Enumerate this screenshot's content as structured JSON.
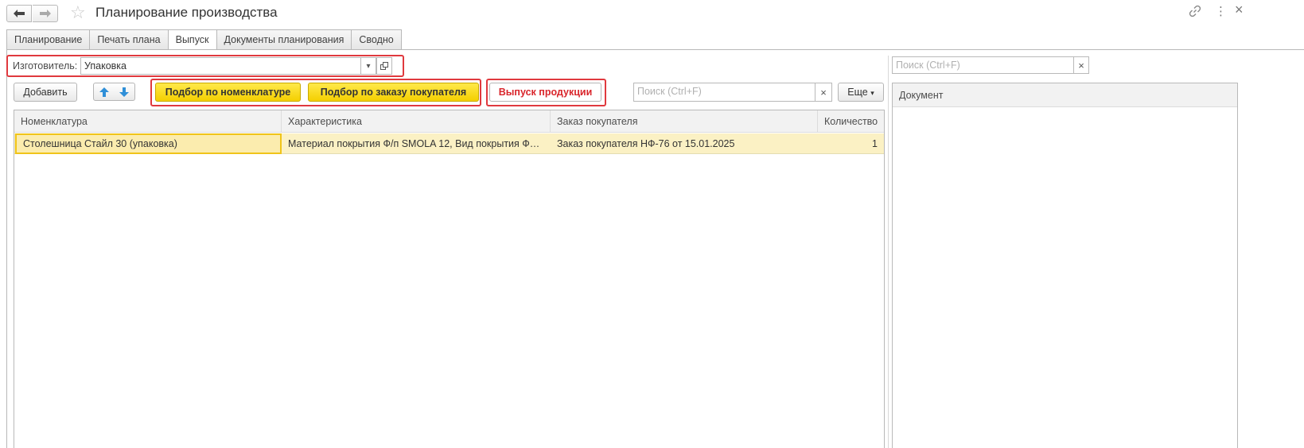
{
  "window": {
    "title": "Планирование производства"
  },
  "tabs": [
    {
      "label": "Планирование",
      "active": false
    },
    {
      "label": "Печать плана",
      "active": false
    },
    {
      "label": "Выпуск",
      "active": true
    },
    {
      "label": "Документы планирования",
      "active": false
    },
    {
      "label": "Сводно",
      "active": false
    }
  ],
  "manufacturer": {
    "label": "Изготовитель:",
    "value": "Упаковка"
  },
  "toolbar": {
    "add_label": "Добавить",
    "pick_by_nomenclature": "Подбор по номенклатуре",
    "pick_by_customer_order": "Подбор по заказу покупателя",
    "release_production": "Выпуск продукции",
    "search_placeholder": "Поиск (Ctrl+F)",
    "more_label": "Еще"
  },
  "table": {
    "columns": [
      "Номенклатура",
      "Характеристика",
      "Заказ покупателя",
      "Количество"
    ],
    "rows": [
      {
        "nomenclature": "Столешница Стайл 30 (упаковка)",
        "characteristic": "Материал покрытия Ф/п SMOLA 12, Вид покрытия Ф…",
        "order": "Заказ покупателя НФ-76 от 15.01.2025",
        "quantity": "1"
      }
    ]
  },
  "right_panel": {
    "search_placeholder": "Поиск (Ctrl+F)",
    "columns": [
      "Документ"
    ]
  },
  "icons": {
    "back": "arrow-left-icon",
    "forward": "arrow-right-icon",
    "favorite": "star-icon",
    "link": "link-icon",
    "menu": "more-vertical-icon",
    "up": "arrow-up-icon",
    "down": "arrow-down-icon"
  },
  "colors": {
    "highlight_red": "#e0393e",
    "yellow_button": "#f4cf00",
    "row_selected": "#fbf1c4"
  }
}
